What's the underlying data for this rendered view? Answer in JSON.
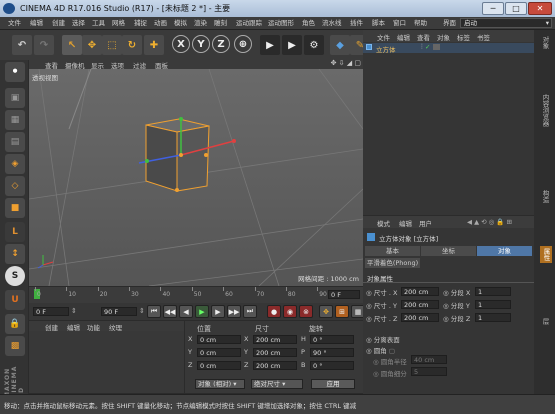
{
  "window": {
    "title": "CINEMA 4D R17.016 Studio (R17) - [未标题 2 *] - 主要",
    "min": "─",
    "max": "□",
    "close": "✕"
  },
  "menubar": {
    "items": [
      "文件",
      "编辑",
      "创建",
      "选择",
      "工具",
      "网格",
      "捕捉",
      "动画",
      "模拟",
      "渲染",
      "雕刻",
      "运动跟踪",
      "运动图形",
      "角色",
      "流水线",
      "插件",
      "脚本",
      "窗口",
      "帮助"
    ],
    "layout_label": "界面",
    "layout_value": "启动"
  },
  "toolbar": {
    "tools": [
      {
        "name": "undo",
        "glyph": "↶",
        "color": "#cfcfcf"
      },
      {
        "name": "redo",
        "glyph": "↷",
        "color": "#777"
      },
      {
        "name": "live-select",
        "glyph": "↖",
        "color": "#e0a030"
      },
      {
        "name": "move",
        "glyph": "✥",
        "color": "#f0b030"
      },
      {
        "name": "scale",
        "glyph": "⬚",
        "color": "#f0b030"
      },
      {
        "name": "rotate",
        "glyph": "↻",
        "color": "#f0b030"
      },
      {
        "name": "recent-tool",
        "glyph": "✚",
        "color": "#f0b030"
      },
      {
        "name": "x-axis",
        "glyph": "X",
        "color": "#eee"
      },
      {
        "name": "y-axis",
        "glyph": "Y",
        "color": "#eee"
      },
      {
        "name": "z-axis",
        "glyph": "Z",
        "color": "#eee"
      },
      {
        "name": "coord-system",
        "glyph": "⊕",
        "color": "#eee"
      },
      {
        "name": "render-view",
        "glyph": "▶",
        "color": "#eee"
      },
      {
        "name": "render-picture",
        "glyph": "▶",
        "color": "#eee"
      },
      {
        "name": "render-settings",
        "glyph": "⚙",
        "color": "#eee"
      },
      {
        "name": "cube",
        "glyph": "◆",
        "color": "#5aa0e0"
      },
      {
        "name": "pen",
        "glyph": "✎",
        "color": "#e0a030"
      }
    ]
  },
  "left_tools": {
    "items": [
      {
        "name": "make-editable",
        "glyph": "⚫"
      },
      {
        "name": "model-mode",
        "glyph": "▣"
      },
      {
        "name": "texture-mode",
        "glyph": "▦"
      },
      {
        "name": "workplane",
        "glyph": "▤"
      },
      {
        "name": "points-mode",
        "glyph": "◈"
      },
      {
        "name": "edges-mode",
        "glyph": "◇"
      },
      {
        "name": "polygons-mode",
        "glyph": "■"
      },
      {
        "name": "axis-mode",
        "glyph": "L"
      },
      {
        "name": "tweak-mode",
        "glyph": "↕"
      },
      {
        "name": "snap",
        "glyph": "S"
      },
      {
        "name": "magnet",
        "glyph": "U"
      },
      {
        "name": "lock",
        "glyph": "🔒"
      },
      {
        "name": "grid-checker",
        "glyph": "▩"
      }
    ],
    "brand": "MAXON CINEMA 4D"
  },
  "viewport": {
    "menu": [
      "查看",
      "摄像机",
      "显示",
      "选项",
      "过滤",
      "面板"
    ],
    "label": "透视视图",
    "grid_info": "网格间距 : 1000 cm"
  },
  "timeline": {
    "ticks": [
      "0",
      "10",
      "20",
      "30",
      "40",
      "50",
      "60",
      "70",
      "80",
      "90"
    ],
    "frame_field": "0 F",
    "start_field": "0 F",
    "end_field": "90 F",
    "current_field": "90 F"
  },
  "material": {
    "menu": [
      "创建",
      "编辑",
      "功能",
      "纹理"
    ]
  },
  "coords": {
    "headers": [
      "位置",
      "尺寸",
      "旋转"
    ],
    "rows": [
      {
        "axis": "X",
        "pos": "0 cm",
        "size": "200 cm",
        "rot_axis": "H",
        "rot": "0 °"
      },
      {
        "axis": "Y",
        "pos": "0 cm",
        "size": "200 cm",
        "rot_axis": "P",
        "rot": "90 °"
      },
      {
        "axis": "Z",
        "pos": "0 cm",
        "size": "200 cm",
        "rot_axis": "B",
        "rot": "0 °"
      }
    ],
    "mode": "对象 (相对)",
    "size_mode": "绝对尺寸",
    "apply": "应用"
  },
  "object_manager": {
    "menu": [
      "文件",
      "编辑",
      "查看",
      "对象",
      "标签",
      "书签"
    ],
    "objects": [
      {
        "name": "立方体"
      }
    ]
  },
  "attributes": {
    "menu": [
      "模式",
      "编辑",
      "用户"
    ],
    "title": "立方体对象 [立方体]",
    "tabs": [
      "基本",
      "坐标",
      "对象"
    ],
    "active_tab": "对象",
    "phong_tab": "平滑着色(Phong)",
    "section": "对象属性",
    "size_rows": [
      {
        "label": "尺寸 . X",
        "value": "200 cm",
        "seg_label": "分段 X",
        "seg": "1"
      },
      {
        "label": "尺寸 . Y",
        "value": "200 cm",
        "seg_label": "分段 Y",
        "seg": "1"
      },
      {
        "label": "尺寸 . Z",
        "value": "200 cm",
        "seg_label": "分段 Z",
        "seg": "1"
      }
    ],
    "separate_surfaces": "分离表面",
    "fillet": "圆角",
    "fillet_radius_label": "圆角半径",
    "fillet_radius": "40 cm",
    "fillet_subdiv_label": "圆角细分",
    "fillet_subdiv": "5"
  },
  "right_strip": {
    "tabs": [
      "对象",
      "内容浏览器",
      "构造",
      "属性",
      "层"
    ]
  },
  "status": {
    "text": "移动：点击并拖动鼠标移动元素。按住 SHIFT 键量化移动；节点编辑模式时按住 SHIFT 键增加选择对象；按住 CTRL 键减"
  },
  "colors": {
    "accent_orange": "#f0a030",
    "selection_blue": "#4a7ab0",
    "bg_dark": "#2b2b2b"
  }
}
